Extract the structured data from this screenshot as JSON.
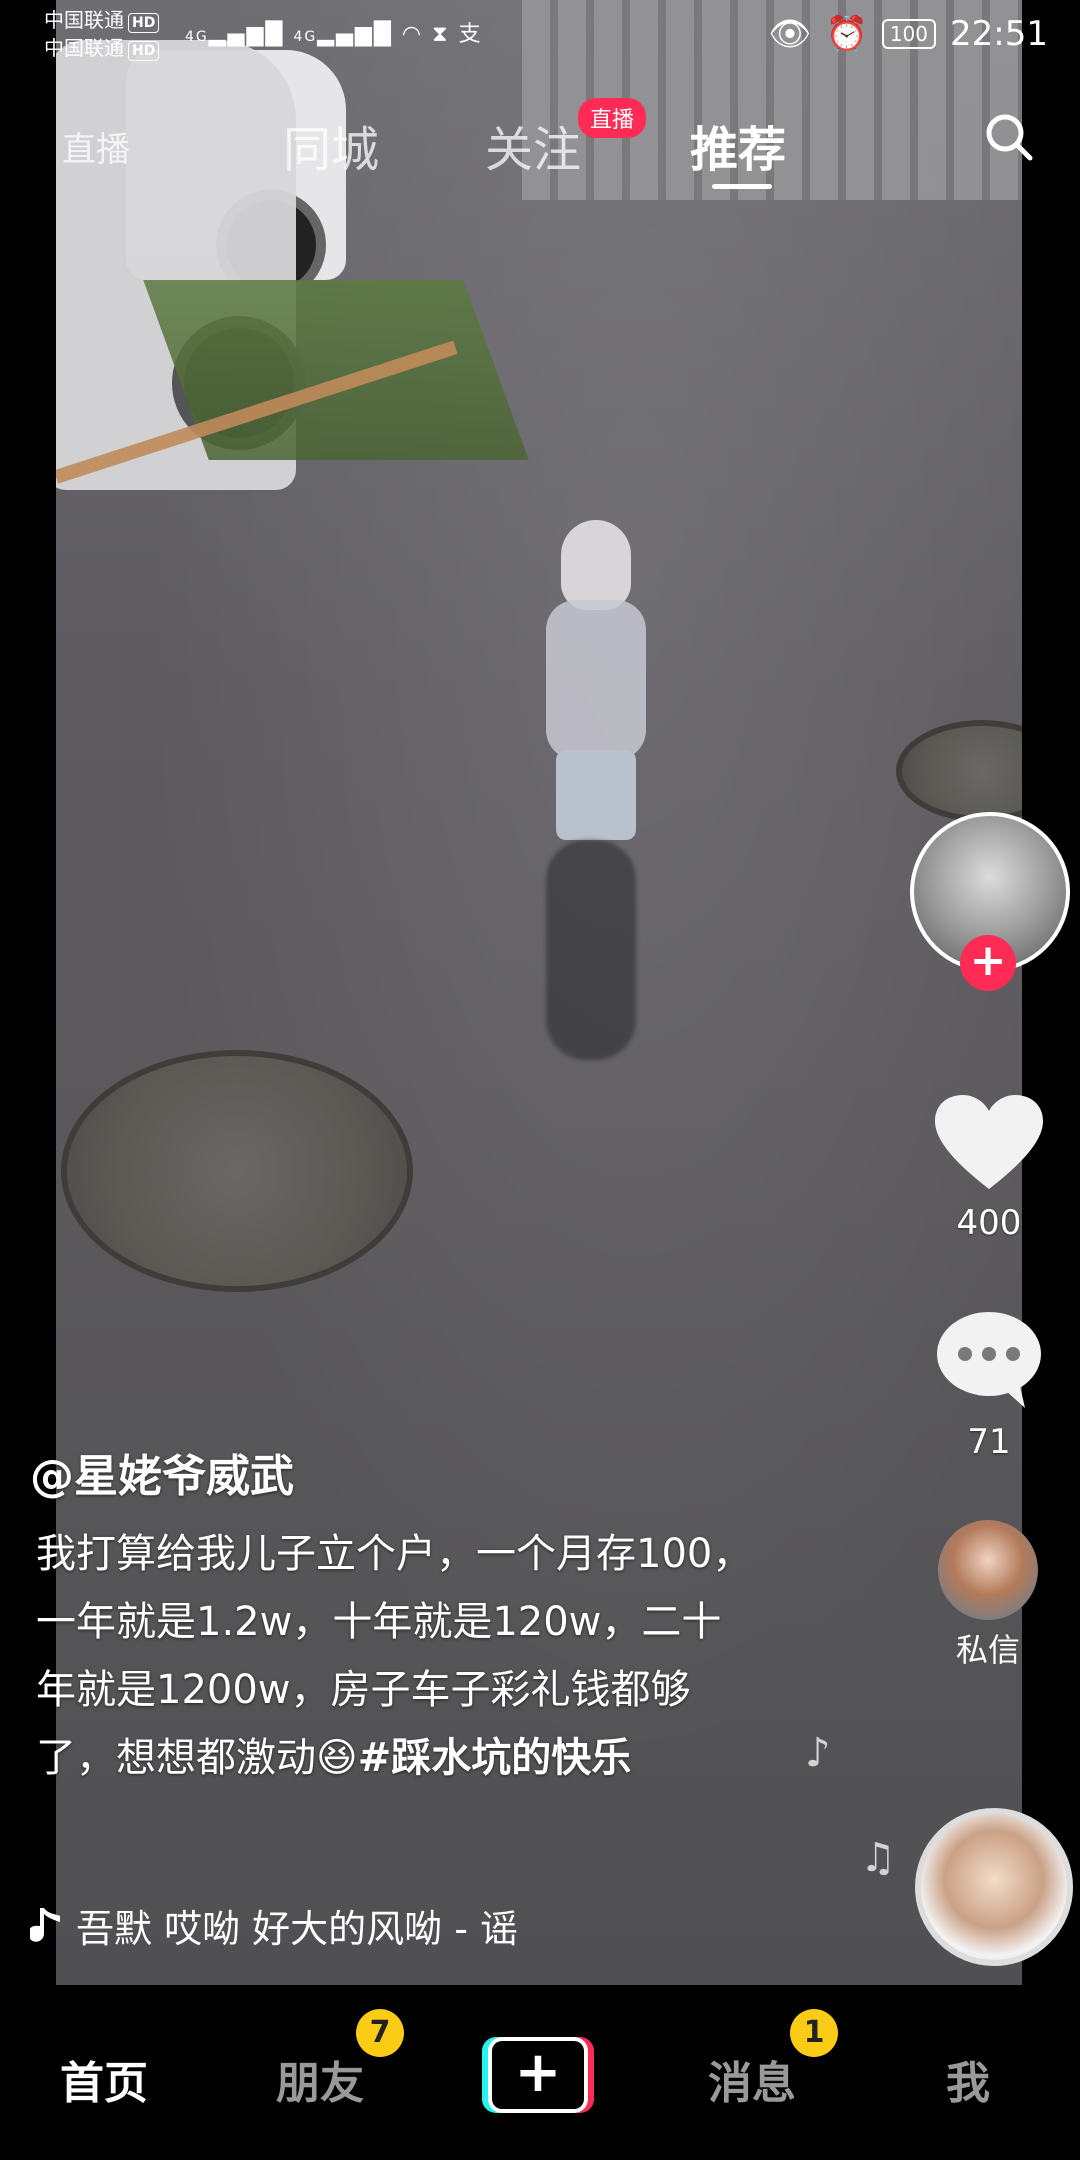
{
  "status_bar": {
    "carrier1": "中国联通",
    "carrier2": "中国联通",
    "hd": "HD",
    "network": "4G",
    "battery": "100",
    "time": "22:51"
  },
  "top_nav": {
    "tabs": [
      "直播",
      "同城",
      "关注",
      "推荐"
    ],
    "active_tab": "推荐",
    "follow_badge": "直播"
  },
  "video": {
    "author": "@星姥爷威武",
    "caption": "我打算给我儿子立个户，一个月存100，一年就是1.2w，十年就是120w，二十年就是1200w，房子车子彩礼钱都够了，想想都激动😆",
    "hashtag": "#踩水坑的快乐",
    "song": "吾默    哎呦 好大的风呦 - 谣"
  },
  "actions": {
    "likes": "400",
    "comments": "71",
    "dm_label": "私信"
  },
  "bottom_nav": {
    "items": [
      "首页",
      "朋友",
      "+",
      "消息",
      "我"
    ],
    "friends_badge": "7",
    "messages_badge": "1"
  },
  "colors": {
    "accent_red": "#fe2c55",
    "badge_yellow": "#facc15",
    "accent_cyan": "#25f4ee"
  }
}
